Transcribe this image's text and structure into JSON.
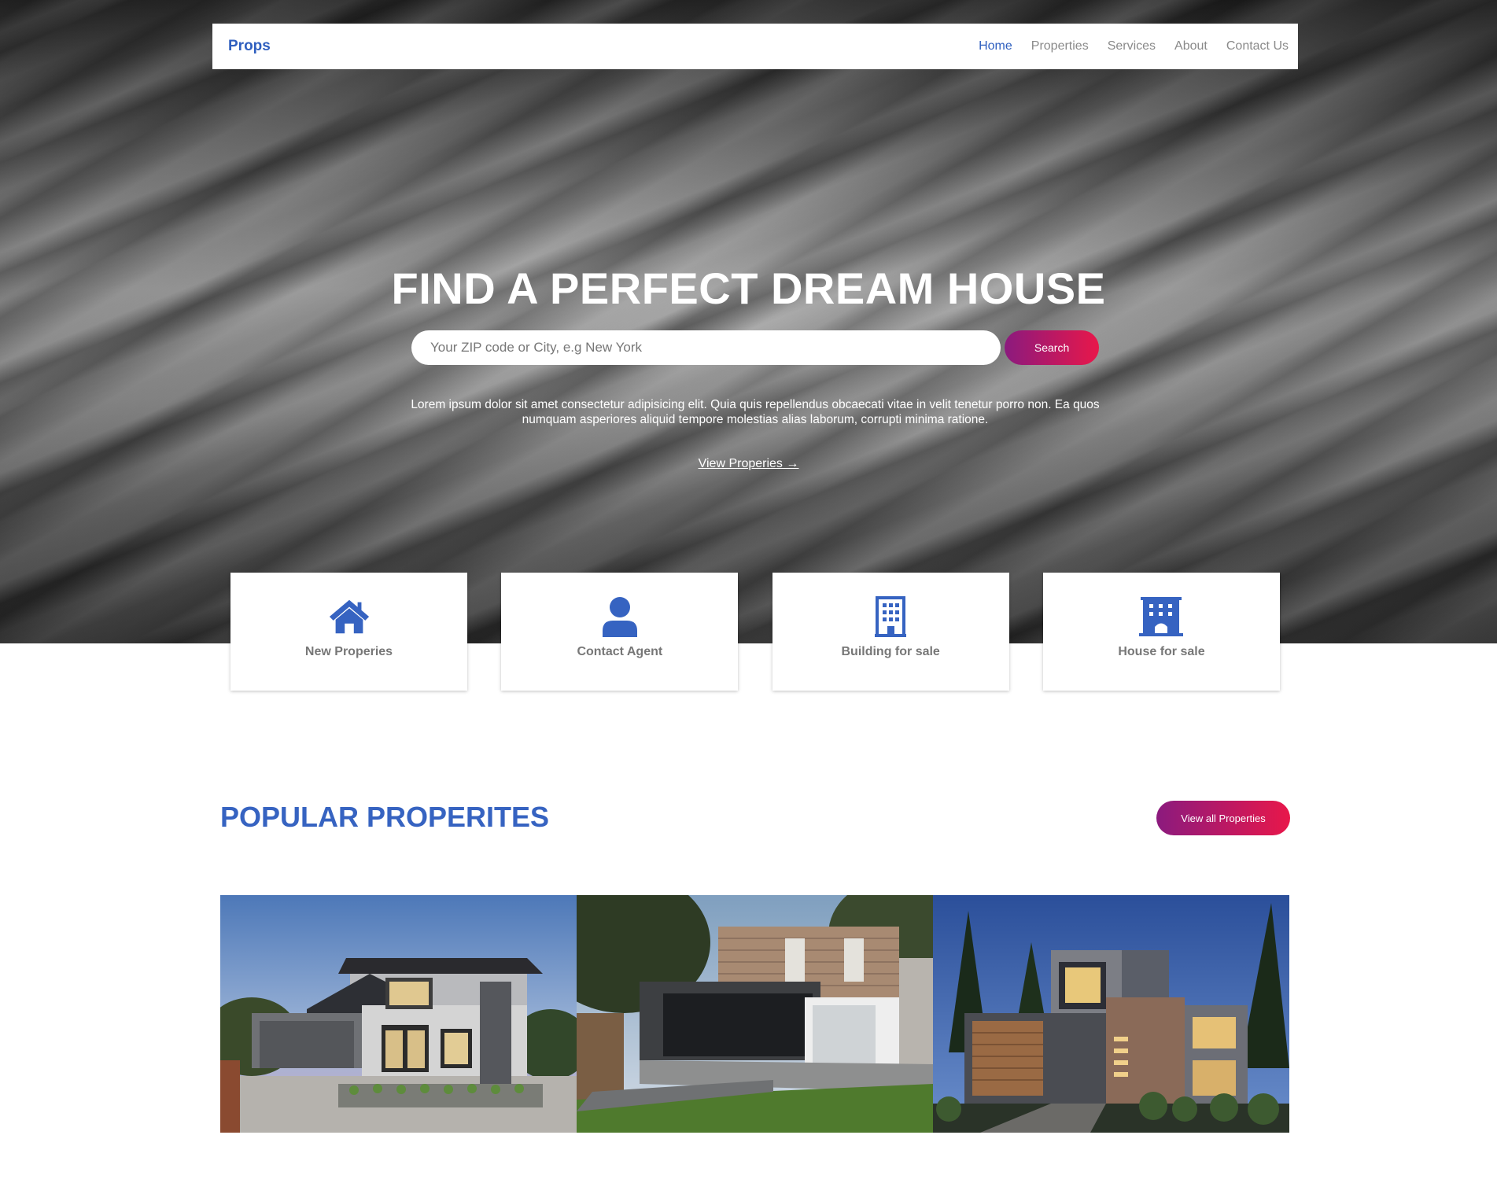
{
  "nav": {
    "brand": "Props",
    "links": [
      "Home",
      "Properties",
      "Services",
      "About",
      "Contact Us"
    ],
    "active": "Home"
  },
  "hero": {
    "title": "FIND A PERFECT DREAM HOUSE",
    "search_placeholder": "Your ZIP code or City, e.g New York",
    "search_button": "Search",
    "description": "Lorem ipsum dolor sit amet consectetur adipisicing elit. Quia quis repellendus obcaecati vitae in velit tenetur porro non. Ea quos numquam asperiores aliquid tempore molestias alias laborum, corrupti minima ratione.",
    "view_link": "View Properies →"
  },
  "features": [
    {
      "label": "New Properies",
      "icon": "house-icon"
    },
    {
      "label": "Contact Agent",
      "icon": "user-icon"
    },
    {
      "label": "Building for sale",
      "icon": "building-icon"
    },
    {
      "label": "House for sale",
      "icon": "hotel-icon"
    }
  ],
  "popular": {
    "title": "POPULAR PROPERITES",
    "view_all": "View all Properties"
  },
  "colors": {
    "accent_blue": "#3663c1",
    "gradient_start": "#8b1a7e",
    "gradient_end": "#e8174a"
  }
}
